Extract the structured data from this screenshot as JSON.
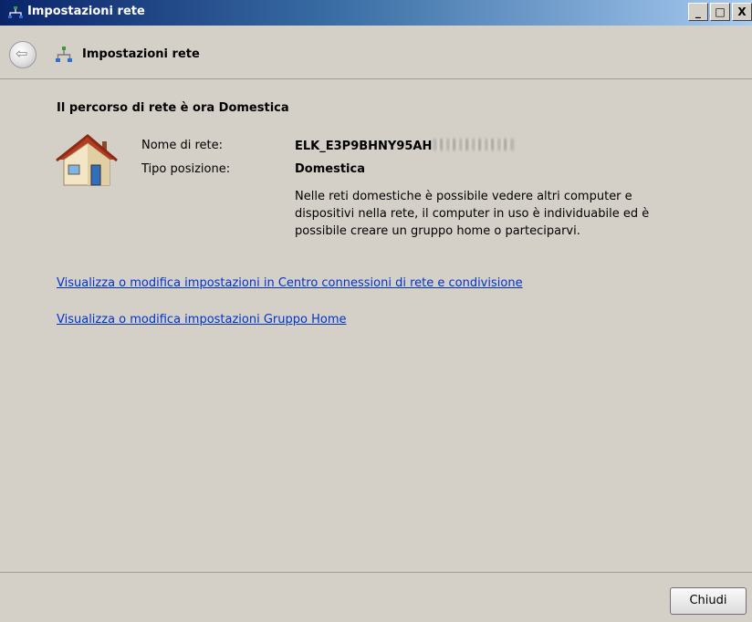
{
  "window": {
    "title": "Impostazioni rete",
    "minimize_glyph": "_",
    "maximize_glyph": "□",
    "close_glyph": "X"
  },
  "nav": {
    "title": "Impostazioni rete",
    "back_icon": "back-arrow-icon"
  },
  "content": {
    "heading": "Il percorso di rete è ora Domestica",
    "network_name_label": "Nome di rete:",
    "network_name_value": "ELK_E3P9BHNY95AH",
    "location_type_label": "Tipo posizione:",
    "location_type_value": "Domestica",
    "description": "Nelle reti domestiche è possibile vedere altri computer e dispositivi nella rete, il computer in uso è individuabile ed è possibile creare un gruppo home o parteciparvi.",
    "links": [
      "Visualizza o modifica impostazioni in Centro connessioni di rete e condivisione",
      "Visualizza o modifica impostazioni Gruppo Home"
    ]
  },
  "footer": {
    "close_label": "Chiudi"
  },
  "colors": {
    "window_bg": "#d4d0c8",
    "title_bar_start": "#0a246a",
    "title_bar_end": "#a6caf0",
    "link": "#0033cc"
  }
}
